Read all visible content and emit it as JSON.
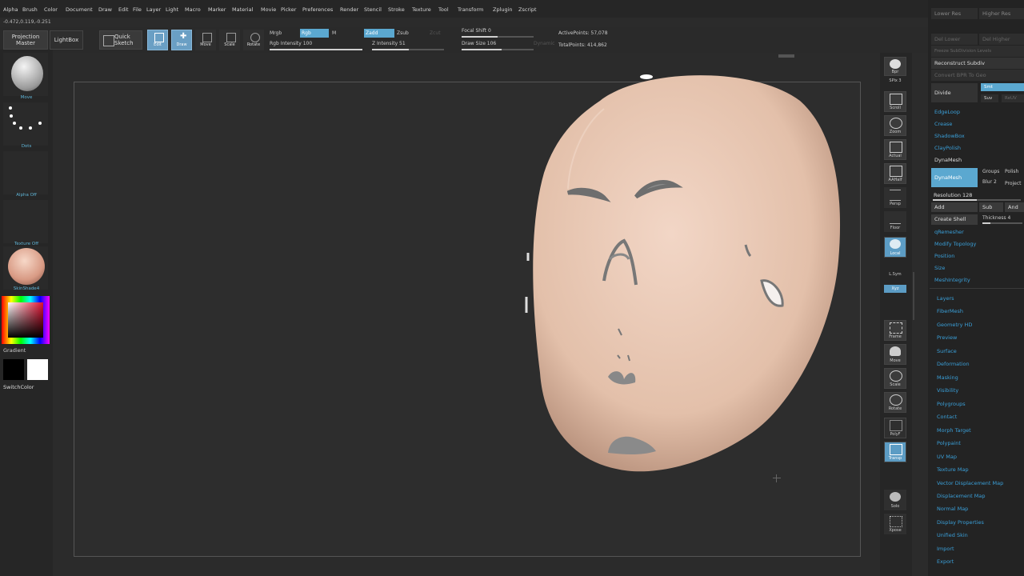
{
  "menu": [
    "Alpha",
    "Brush",
    "Color",
    "Document",
    "Draw",
    "Edit",
    "File",
    "Layer",
    "Light",
    "Macro",
    "Marker",
    "Material",
    "Movie",
    "Picker",
    "Preferences",
    "Render",
    "Stencil",
    "Stroke",
    "Texture",
    "Tool",
    "Transform",
    "Zplugin",
    "Zscript"
  ],
  "coords": "-0.472,0.119,-0.251",
  "toolbar": {
    "projection_master": "Projection Master",
    "lightbox": "LightBox",
    "quick_sketch": "Quick Sketch",
    "edit": "Edit",
    "draw": "Draw",
    "move": "Move",
    "scale": "Scale",
    "rotate": "Rotate",
    "mrgb": "Mrgb",
    "rgb": "Rgb",
    "m": "M",
    "zadd": "Zadd",
    "zsub": "Zsub",
    "zcut": "Zcut",
    "rgb_intensity": "Rgb Intensity 100",
    "z_intensity": "Z Intensity 51",
    "focal_shift": "Focal Shift 0",
    "draw_size": "Draw Size 106",
    "dynamic": "Dynamic",
    "active_points": "ActivePoints: 57,078",
    "total_points": "TotalPoints: 414,862"
  },
  "left": {
    "brush_label": "Move",
    "stroke_label": "Dots",
    "alpha_label": "Alpha Off",
    "texture_label": "Texture Off",
    "material_label": "SkinShade4",
    "gradient": "Gradient",
    "switch_color": "SwitchColor"
  },
  "right_shelf": [
    "Bpr",
    "SPix 3",
    "Scroll",
    "Zoom",
    "Actual",
    "AAHalf",
    "Persp",
    "Floor",
    "Local",
    "L.Sym",
    "Xyz",
    "Frame",
    "Move",
    "Scale",
    "Rotate",
    "PolyF",
    "Transp",
    "Solo",
    "Xpose"
  ],
  "panel": {
    "top": [
      "Lower Res",
      "Higher Res",
      "Del Lower",
      "Del Higher",
      "Freeze SubDivision Levels"
    ],
    "reconstruct": "Reconstruct Subdiv",
    "convert": "Convert BPR To Geo",
    "divide": "Divide",
    "smt": "Smt",
    "suv": "Suv",
    "rsuv": "ReUV",
    "items1": [
      "EdgeLoop",
      "Crease",
      "ShadowBox",
      "ClayPolish"
    ],
    "dynamesh_header": "DynaMesh",
    "dynamesh_btn": "DynaMesh",
    "groups": "Groups",
    "polish": "Polish",
    "blur": "Blur 2",
    "project": "Project",
    "resolution": "Resolution 128",
    "add": "Add",
    "sub": "Sub",
    "and": "And",
    "create_shell": "Create Shell",
    "thickness": "Thickness 4",
    "items2": [
      "qRemesher",
      "Modify Topology",
      "Position",
      "Size",
      "MeshIntegrity"
    ],
    "sections": [
      "Layers",
      "FiberMesh",
      "Geometry HD",
      "Preview",
      "Surface",
      "Deformation",
      "Masking",
      "Visibility",
      "Polygroups",
      "Contact",
      "Morph Target",
      "Polypaint",
      "UV Map",
      "Texture Map",
      "Vector Displacement Map",
      "Displacement Map",
      "Normal Map",
      "Display Properties",
      "Unified Skin",
      "Import",
      "Export"
    ]
  },
  "colors": {
    "accent_blue": "#5ba8d0",
    "panel_text_blue": "#3a9fd8",
    "head_skin": "#e8c8b4",
    "background": "#2b2b2b"
  }
}
